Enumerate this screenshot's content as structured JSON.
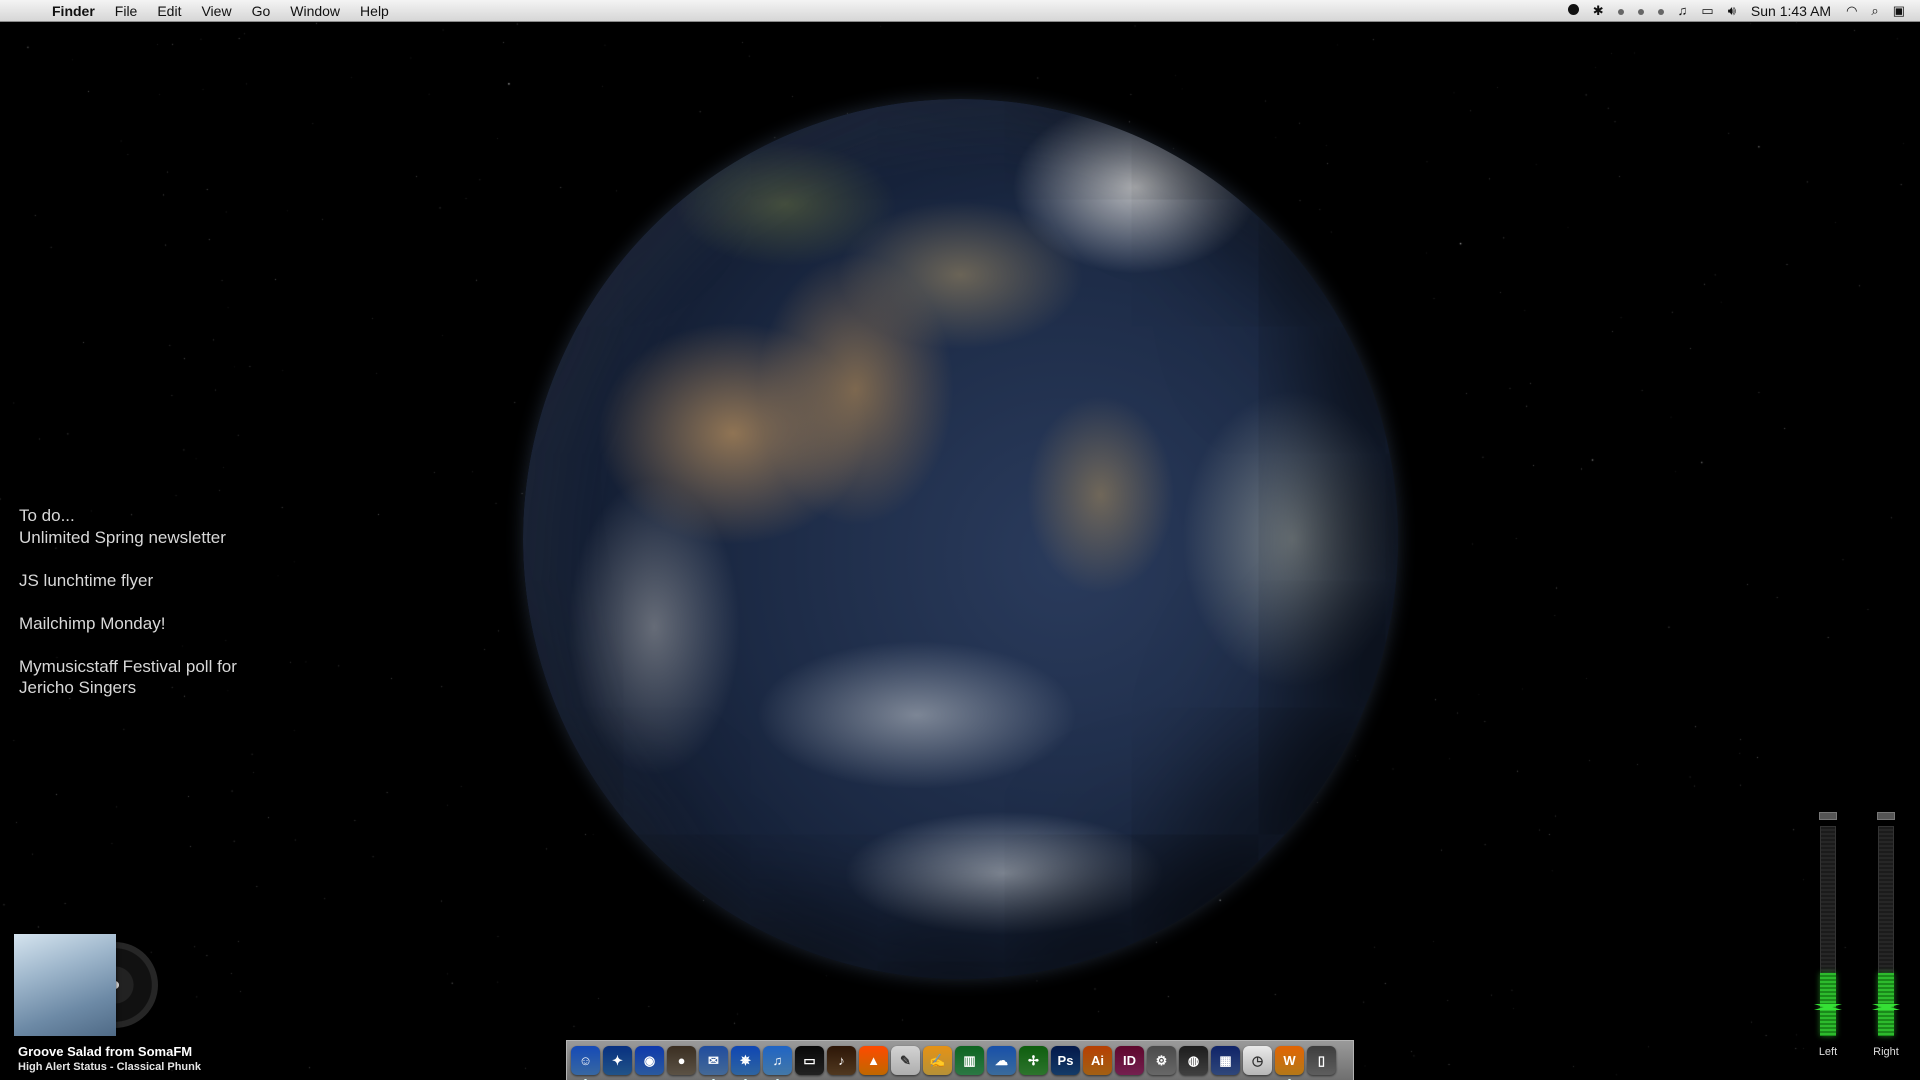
{
  "menubar": {
    "app": "Finder",
    "menus": [
      "File",
      "Edit",
      "View",
      "Go",
      "Window",
      "Help"
    ],
    "clock": "Sun 1:43 AM"
  },
  "todo": {
    "header": "To do...",
    "items": [
      "Unlimited Spring newsletter",
      "JS lunchtime flyer",
      "Mailchimp Monday!",
      "Mymusicstaff Festival poll for",
      "Jericho Singers"
    ]
  },
  "now_playing": {
    "title": "Groove Salad from SomaFM",
    "subtitle": "High Alert Status - Classical Phunk"
  },
  "vu_meters": {
    "left": {
      "label": "Left",
      "level": 0.3,
      "peak": 0.16
    },
    "right": {
      "label": "Right",
      "level": 0.3,
      "peak": 0.16
    }
  },
  "dock": {
    "colors": {
      "finder": "#4a8ad8",
      "ps": "#1b4f8a",
      "ai": "#d8801a",
      "id": "#9b2a6a",
      "vlc": "#ff8a00"
    },
    "icons": [
      {
        "name": "finder-icon",
        "glyph": "☺",
        "bg": "#4a8ad8",
        "running": true
      },
      {
        "name": "transmit-icon",
        "glyph": "✦",
        "bg": "#2c6fb5",
        "running": false
      },
      {
        "name": "google-earth-icon",
        "glyph": "◉",
        "bg": "#3a78d2",
        "running": false
      },
      {
        "name": "disk-icon",
        "glyph": "●",
        "bg": "#7a6d5c",
        "running": false
      },
      {
        "name": "mail-icon",
        "glyph": "✉",
        "bg": "#5b8cc9",
        "running": true
      },
      {
        "name": "safari-icon",
        "glyph": "✵",
        "bg": "#3e86d6",
        "running": true
      },
      {
        "name": "itunes-icon",
        "glyph": "♫",
        "bg": "#5aa0e0",
        "running": true
      },
      {
        "name": "terminal-icon",
        "glyph": "▭",
        "bg": "#2d2d2d",
        "running": false
      },
      {
        "name": "garageband-icon",
        "glyph": "♪",
        "bg": "#6b4b2a",
        "running": false
      },
      {
        "name": "vlc-icon",
        "glyph": "▲",
        "bg": "#ff8a00",
        "running": false
      },
      {
        "name": "textedit-icon",
        "glyph": "✎",
        "bg": "#e8e8e8",
        "running": false
      },
      {
        "name": "pages-icon",
        "glyph": "✍",
        "bg": "#f2c14a",
        "running": false
      },
      {
        "name": "numbers-icon",
        "glyph": "▥",
        "bg": "#3aa05a",
        "running": false
      },
      {
        "name": "cloud-icon",
        "glyph": "☁",
        "bg": "#4e8fd0",
        "running": false
      },
      {
        "name": "grapher-icon",
        "glyph": "✢",
        "bg": "#3c9b3c",
        "running": false
      },
      {
        "name": "photoshop-icon",
        "glyph": "Ps",
        "bg": "#1b4f8a",
        "running": false
      },
      {
        "name": "illustrator-icon",
        "glyph": "Ai",
        "bg": "#d8801a",
        "running": false
      },
      {
        "name": "indesign-icon",
        "glyph": "ID",
        "bg": "#9b2a6a",
        "running": false
      },
      {
        "name": "system-preferences-icon",
        "glyph": "⚙",
        "bg": "#8a8a8a",
        "running": false
      },
      {
        "name": "dvd-icon",
        "glyph": "◍",
        "bg": "#555555",
        "running": false
      },
      {
        "name": "imovie-icon",
        "glyph": "▦",
        "bg": "#3f5fa3",
        "running": false
      },
      {
        "name": "clock-icon",
        "glyph": "◷",
        "bg": "#f4f4f4",
        "running": false
      },
      {
        "name": "widget-icon",
        "glyph": "W",
        "bg": "#f0a020",
        "running": true
      },
      {
        "name": "trash-icon",
        "glyph": "▯",
        "bg": "#7d7d7d",
        "running": false
      }
    ]
  }
}
